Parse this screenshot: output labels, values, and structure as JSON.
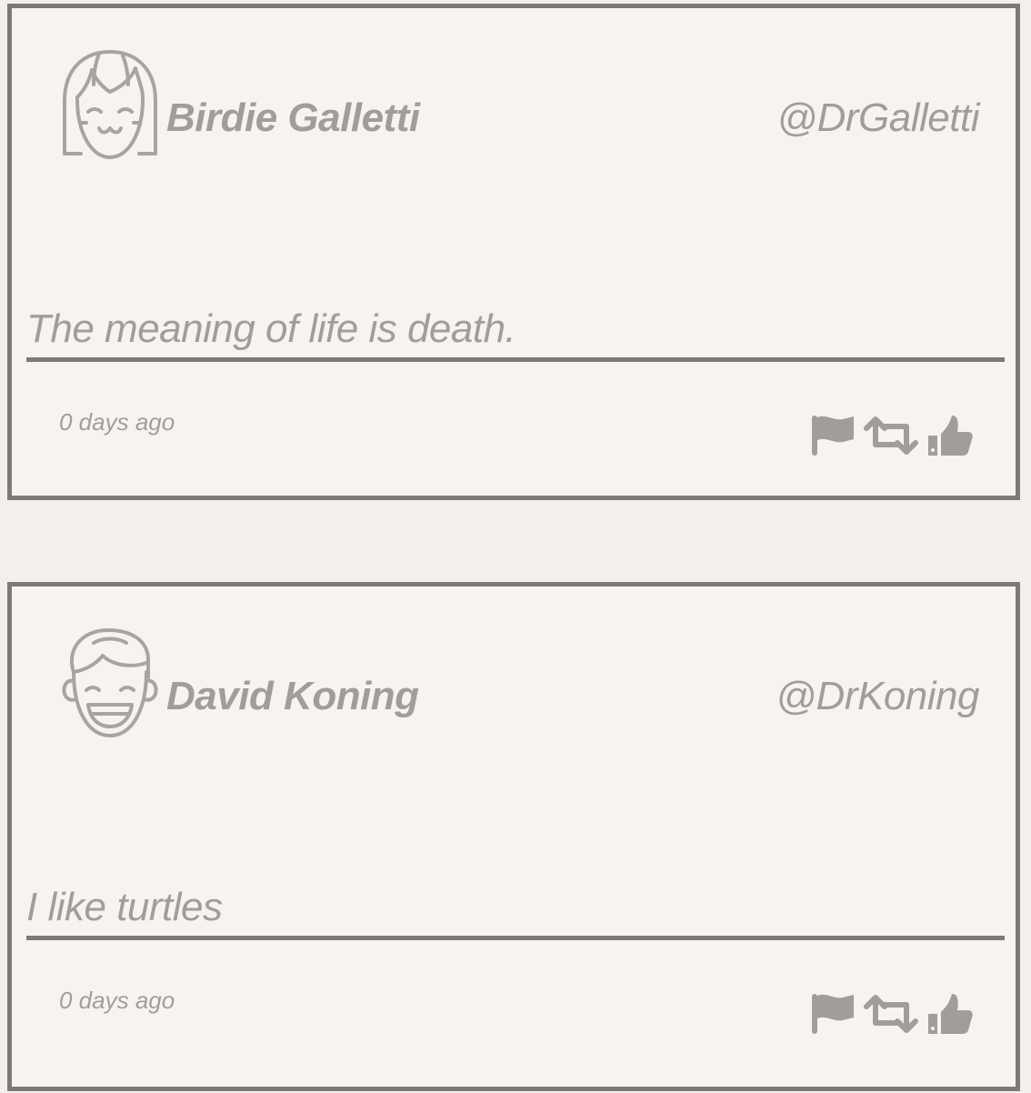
{
  "posts": [
    {
      "name": "Birdie Galletti",
      "handle": "@DrGalletti",
      "message": "The meaning of life is death.",
      "time": "0 days ago",
      "avatar": "girl-avatar-icon"
    },
    {
      "name": "David Koning",
      "handle": "@DrKoning",
      "message": "I like turtles",
      "time": "0 days ago",
      "avatar": "boy-avatar-icon"
    }
  ],
  "actions": [
    "flag-icon",
    "retweet-icon",
    "thumbs-up-icon"
  ],
  "colors": {
    "background": "#f3f0ec",
    "card": "#f7f4f0",
    "border": "#7c7a77",
    "text": "#a19e9a"
  }
}
